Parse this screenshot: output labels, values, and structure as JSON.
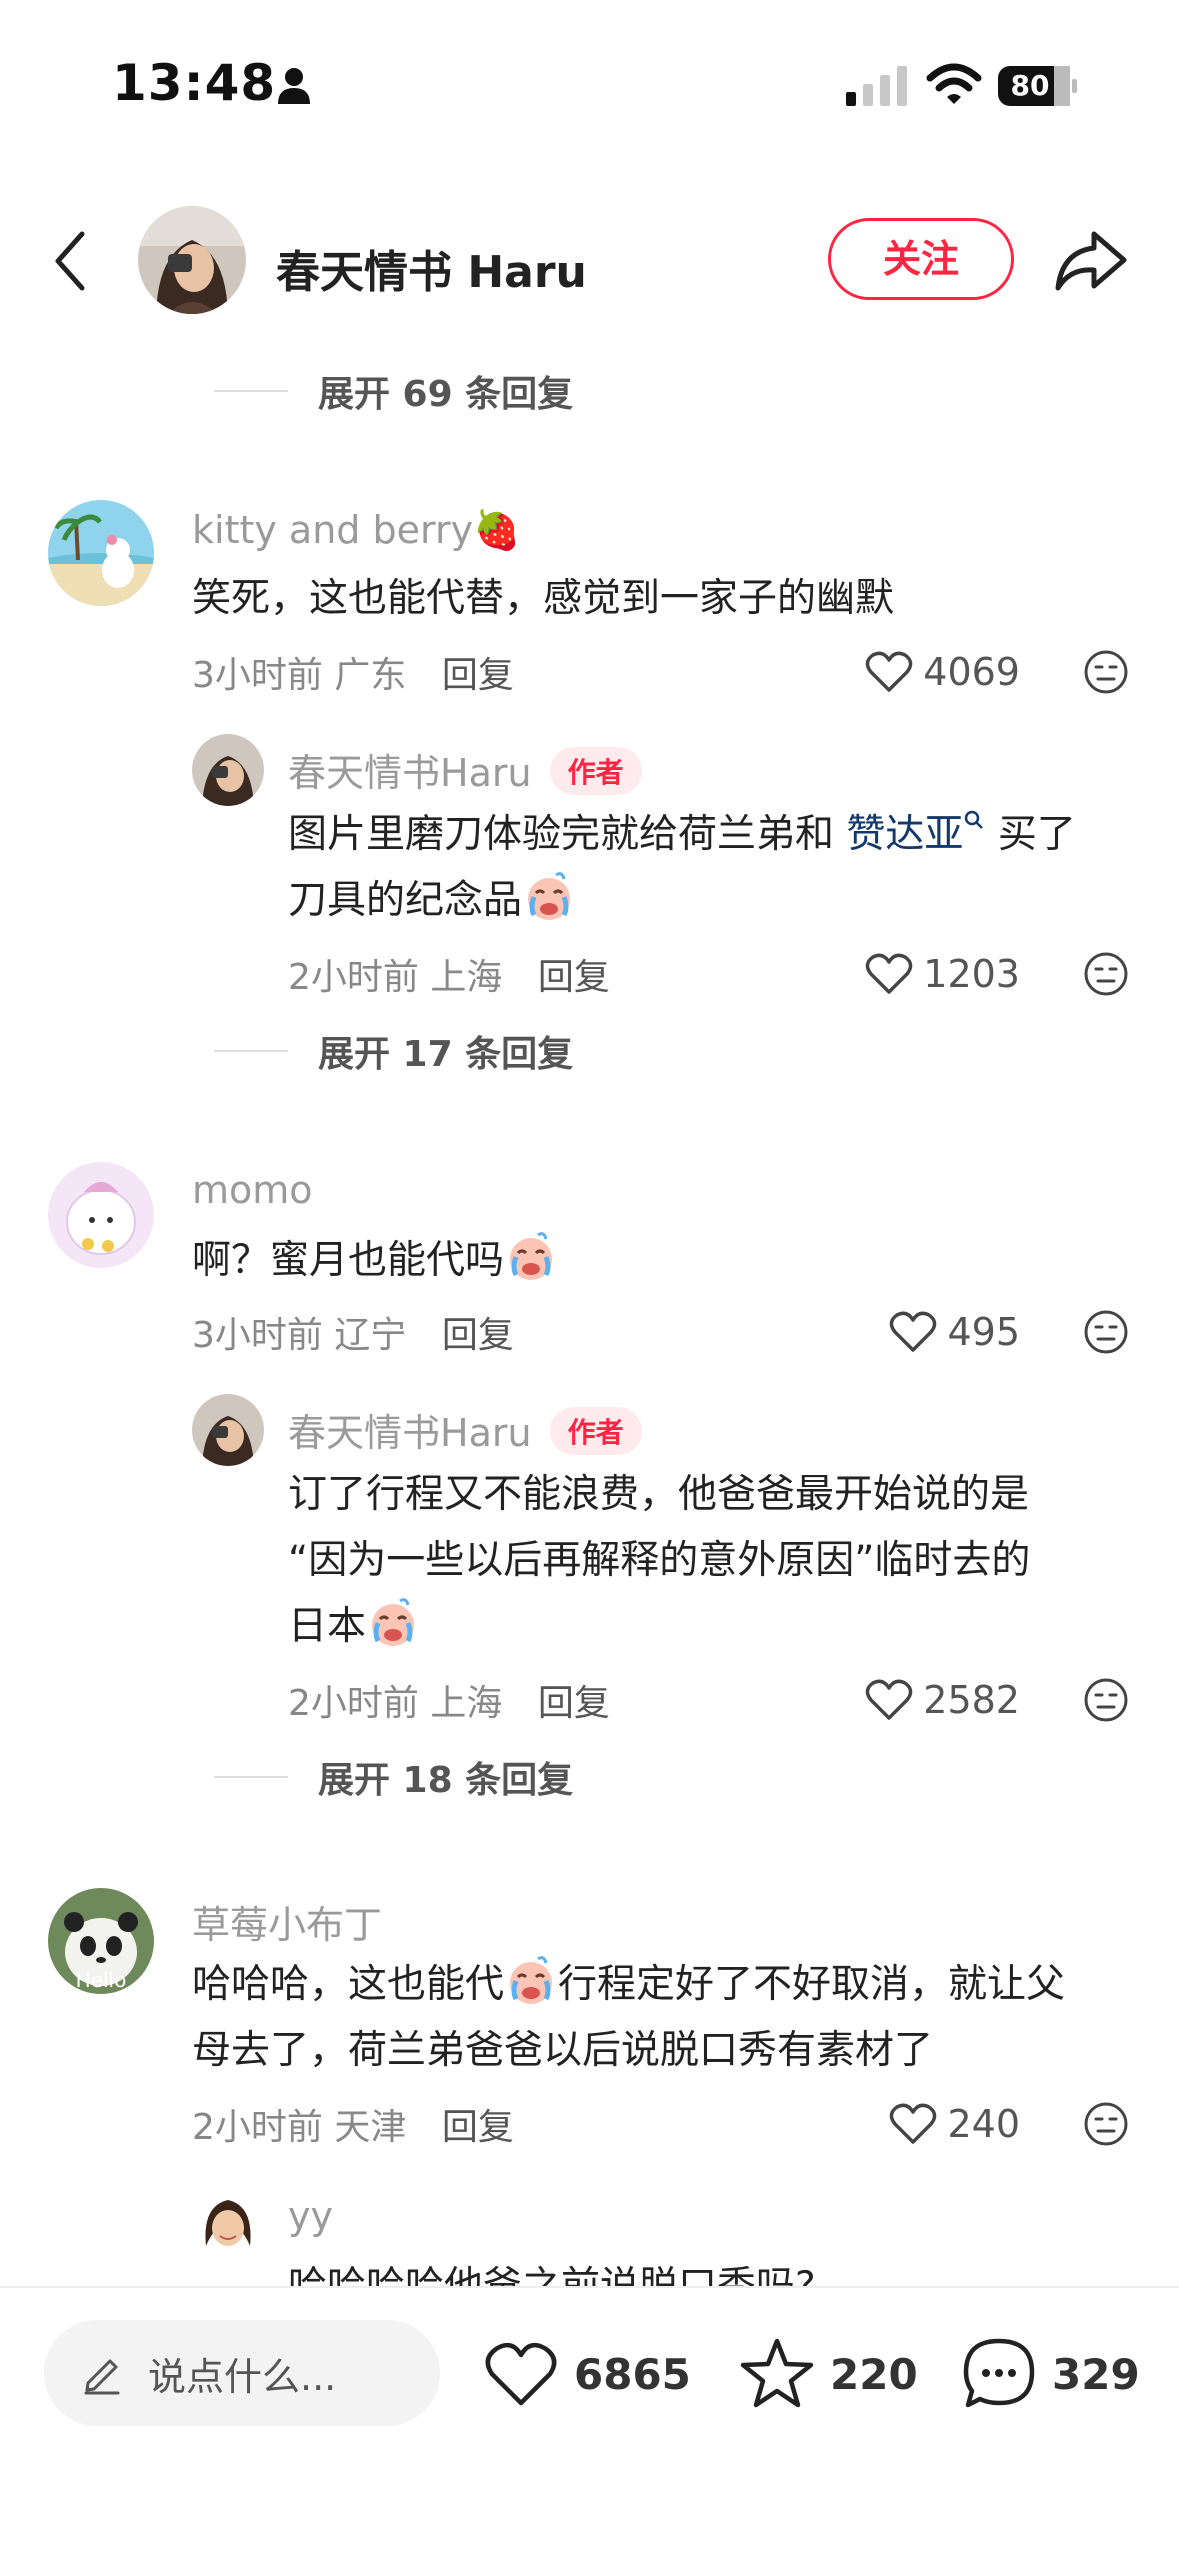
{
  "status_bar": {
    "time": "13:48",
    "battery": "80"
  },
  "header": {
    "name": "春天情书 Haru",
    "follow_label": "关注"
  },
  "expand_top": "展开 69 条回复",
  "comments": [
    {
      "user": "kitty and berry🍓",
      "text": "笑死，这也能代替，感觉到一家子的幽默",
      "time": "3小时前",
      "location": "广东",
      "reply_label": "回复",
      "likes": "4069",
      "reply": {
        "user": "春天情书Haru",
        "badge": "作者",
        "line1_before": "图片里磨刀体验完就给荷兰弟和 ",
        "line1_link": "赞达亚",
        "line1_after": " 买了",
        "line2": "刀具的纪念品",
        "time": "2小时前",
        "location": "上海",
        "reply_label": "回复",
        "likes": "1203"
      },
      "expand": "展开 17 条回复"
    },
    {
      "user": "momo",
      "text": "啊？蜜月也能代吗",
      "time": "3小时前",
      "location": "辽宁",
      "reply_label": "回复",
      "likes": "495",
      "reply": {
        "user": "春天情书Haru",
        "badge": "作者",
        "line1": "订了行程又不能浪费，他爸爸最开始说的是",
        "line2": "“因为一些以后再解释的意外原因”临时去的",
        "line3": "日本",
        "time": "2小时前",
        "location": "上海",
        "reply_label": "回复",
        "likes": "2582"
      },
      "expand": "展开 18 条回复"
    },
    {
      "user": "草莓小布丁",
      "avatar_text": "Hello",
      "line1_before": "哈哈哈，这也能代",
      "line1_after": "行程定好了不好取消，就让父",
      "line2": "母去了，荷兰弟爸爸以后说脱口秀有素材了",
      "time": "2小时前",
      "location": "天津",
      "reply_label": "回复",
      "likes": "240",
      "reply": {
        "user": "yy",
        "text": "哈哈哈哈他爸之前说脱口秀吗?"
      }
    }
  ],
  "bottom_bar": {
    "input_placeholder": "说点什么...",
    "likes": "6865",
    "favorites": "220",
    "comments": "329"
  },
  "colors": {
    "accent": "#ff2442",
    "link": "#13386c",
    "muted": "#9a9a9a"
  }
}
